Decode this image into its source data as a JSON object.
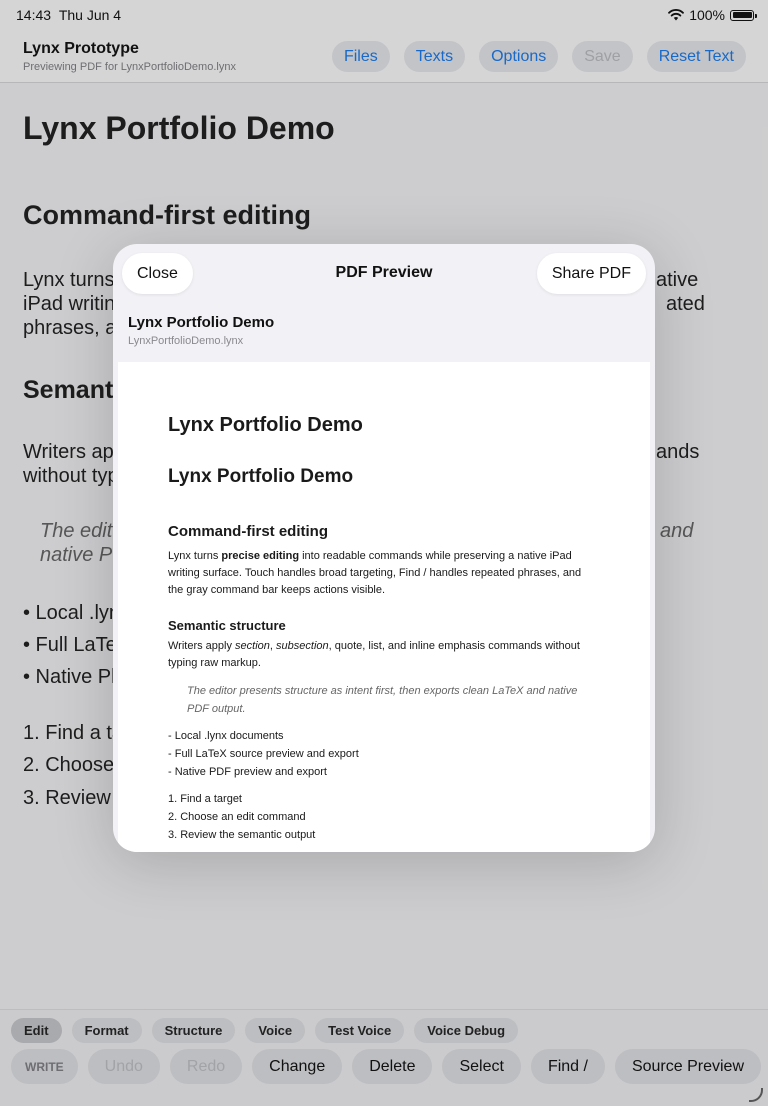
{
  "status": {
    "time": "14:43",
    "date": "Thu Jun 4",
    "battery": "100%"
  },
  "header": {
    "title": "Lynx Prototype",
    "subtitle": "Previewing PDF for LynxPortfolioDemo.lynx",
    "buttons": [
      "Files",
      "Texts",
      "Options",
      "Save",
      "Reset Text"
    ]
  },
  "background_doc": {
    "title": "Lynx Portfolio Demo",
    "section1": "Command-first editing",
    "para1_lines": [
      "Lynx turns",
      "iPad writin",
      "phrases, a"
    ],
    "para1_right": [
      "ative",
      "ated"
    ],
    "section2": "Semant",
    "para2_lines": [
      "Writers ap",
      "without typ"
    ],
    "para2_right": "ands",
    "quote_lines": [
      "The edit",
      "native P"
    ],
    "quote_right": "and",
    "bullets": [
      "• Local .lyn",
      "• Full LaTe",
      "• Native Pl"
    ],
    "numbered": [
      "1. Find a ta",
      "2. Choose",
      "3. Review"
    ]
  },
  "modal": {
    "close_label": "Close",
    "title": "PDF Preview",
    "share_label": "Share PDF",
    "doc_title": "Lynx Portfolio Demo",
    "doc_file": "LynxPortfolioDemo.lynx"
  },
  "pdf": {
    "title1": "Lynx Portfolio Demo",
    "title2": "Lynx Portfolio Demo",
    "section1": "Command-first editing",
    "section1_body_prefix": "Lynx turns ",
    "section1_body_bold": "precise editing",
    "section1_body_rest": " into readable commands while preserving a native iPad writing surface. Touch handles broad targeting, Find / handles repeated phrases, and the gray command bar keeps actions visible.",
    "subsection": "Semantic structure",
    "sub_body_a": "Writers apply ",
    "sub_body_section": "section",
    "sub_body_b": ", ",
    "sub_body_subsection": "subsection",
    "sub_body_c": ", quote, list, and inline emphasis commands without typing raw markup.",
    "quote": "The editor presents structure as intent first, then exports clean LaTeX and native PDF output.",
    "list": [
      "- Local .lynx documents",
      "- Full LaTeX source preview and export",
      "- Native PDF preview and export"
    ],
    "numbered": [
      "1. Find a target",
      "2. Choose an edit command",
      "3. Review the semantic output"
    ]
  },
  "toolbar": {
    "tabs": [
      "Edit",
      "Format",
      "Structure",
      "Voice",
      "Test Voice",
      "Voice Debug"
    ],
    "active_tab": "Edit",
    "actions": [
      "WRITE",
      "Undo",
      "Redo",
      "Change",
      "Delete",
      "Select",
      "Find /",
      "Source Preview"
    ]
  }
}
